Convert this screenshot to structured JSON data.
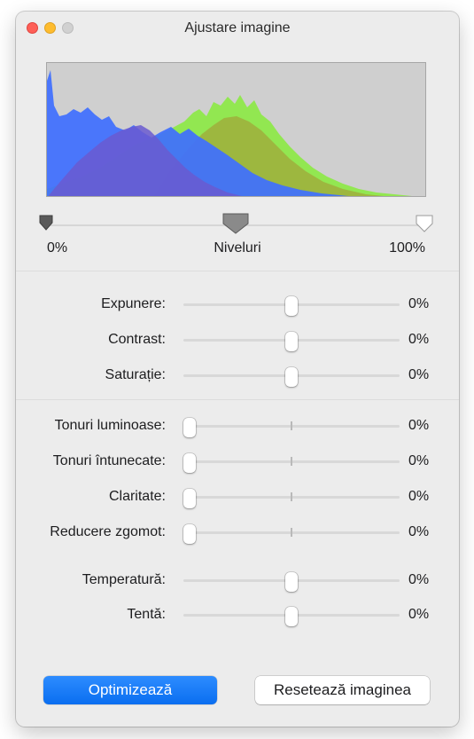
{
  "window": {
    "title": "Ajustare imagine"
  },
  "levels": {
    "min_label": "0%",
    "name": "Niveluri",
    "max_label": "100%",
    "black_point": 0,
    "midpoint": 0.5,
    "white_point": 1
  },
  "adjustments": [
    {
      "label": "Expunere:",
      "value": "0%",
      "position": 0.5,
      "center_tick": false
    },
    {
      "label": "Contrast:",
      "value": "0%",
      "position": 0.5,
      "center_tick": false
    },
    {
      "label": "Saturație:",
      "value": "0%",
      "position": 0.5,
      "center_tick": false
    },
    {
      "label": "Tonuri luminoase:",
      "value": "0%",
      "position": 0.0,
      "center_tick": true
    },
    {
      "label": "Tonuri întunecate:",
      "value": "0%",
      "position": 0.0,
      "center_tick": true
    },
    {
      "label": "Claritate:",
      "value": "0%",
      "position": 0.0,
      "center_tick": true
    },
    {
      "label": "Reducere zgomot:",
      "value": "0%",
      "position": 0.0,
      "center_tick": true
    },
    {
      "label": "Temperatură:",
      "value": "0%",
      "position": 0.5,
      "center_tick": false
    },
    {
      "label": "Tentă:",
      "value": "0%",
      "position": 0.5,
      "center_tick": false
    }
  ],
  "buttons": {
    "optimize": "Optimizează",
    "reset": "Resetează imaginea"
  },
  "colors": {
    "accent": "#0a6ef0",
    "histogram_blue": "#3f6fff",
    "histogram_green": "#8ee84a",
    "histogram_purple": "#6a5bd0",
    "histogram_bg": "#cfcfcf"
  }
}
